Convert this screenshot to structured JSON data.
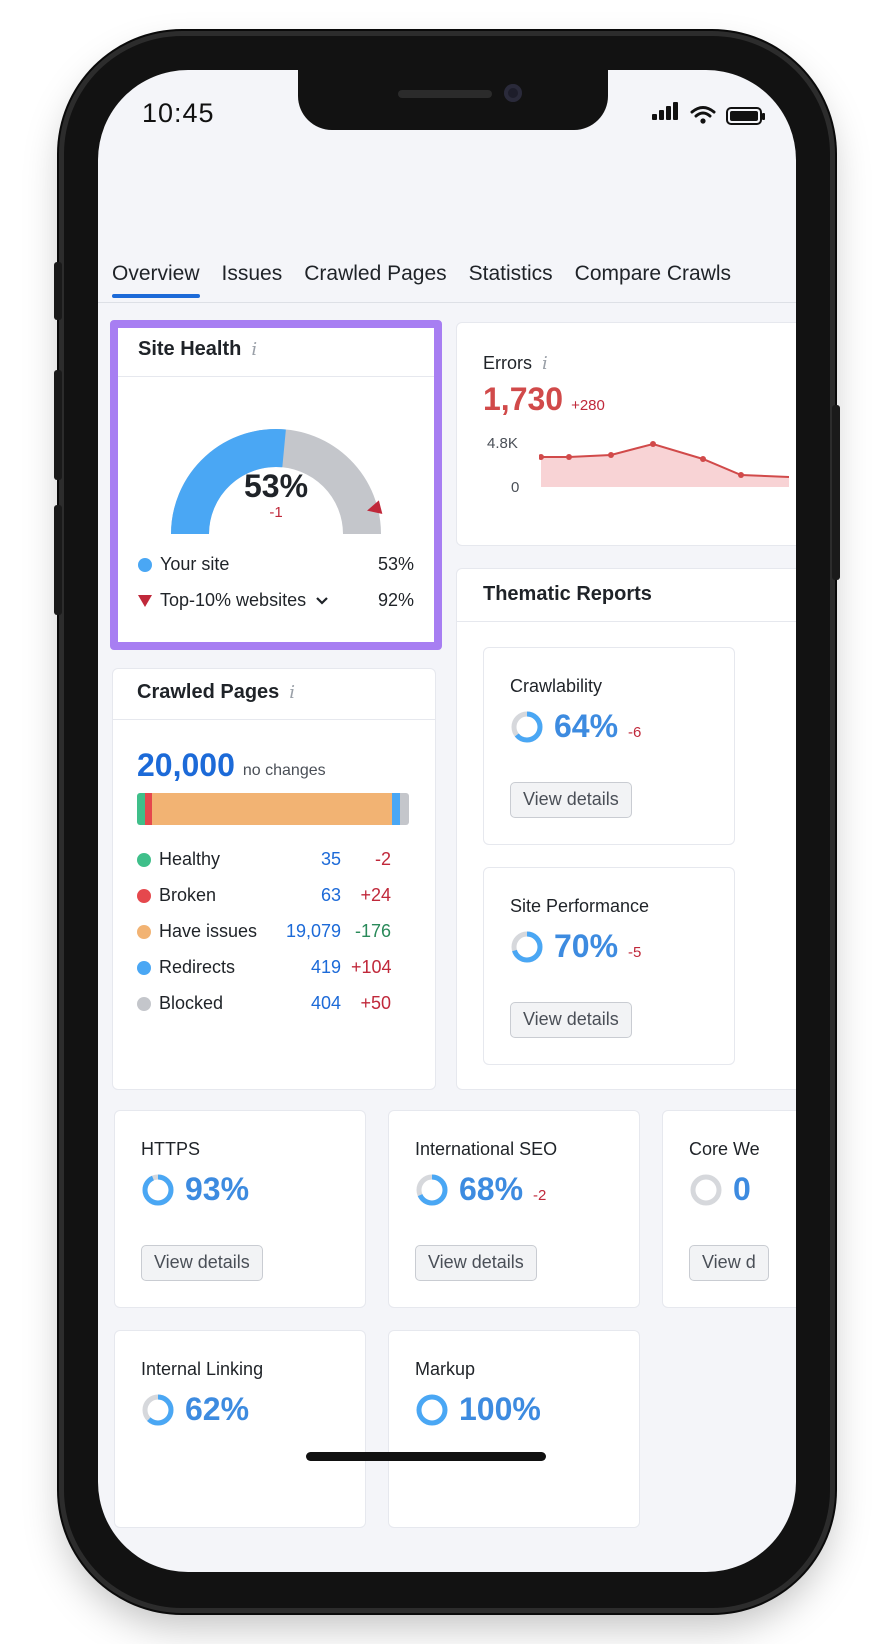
{
  "status_bar": {
    "time": "10:45"
  },
  "tabs": [
    {
      "label": "Overview",
      "active": true
    },
    {
      "label": "Issues"
    },
    {
      "label": "Crawled Pages"
    },
    {
      "label": "Statistics"
    },
    {
      "label": "Compare Crawls"
    }
  ],
  "site_health": {
    "title": "Site Health",
    "value": "53%",
    "delta": "-1",
    "gauge_fraction": 0.53,
    "top10_marker_fraction": 0.92,
    "legend": [
      {
        "label": "Your site",
        "value": "53%",
        "color": "#4aa7f4"
      },
      {
        "label": "Top-10% websites",
        "value": "92%",
        "color": "#c0283a"
      }
    ]
  },
  "errors": {
    "title": "Errors",
    "value": "1,730",
    "delta": "+280",
    "y_max_label": "4.8K",
    "y_min_label": "0"
  },
  "crawled_pages": {
    "title": "Crawled Pages",
    "total": "20,000",
    "total_note": "no changes",
    "rows": [
      {
        "label": "Healthy",
        "value": "35",
        "change": "-2",
        "color": "#3fbf8a",
        "change_color": "#c0283a"
      },
      {
        "label": "Broken",
        "value": "63",
        "change": "+24",
        "color": "#e5484d",
        "change_color": "#c0283a"
      },
      {
        "label": "Have issues",
        "value": "19,079",
        "change": "-176",
        "color": "#f2b373",
        "change_color": "#2a8a5a"
      },
      {
        "label": "Redirects",
        "value": "419",
        "change": "+104",
        "color": "#4aa7f4",
        "change_color": "#c0283a"
      },
      {
        "label": "Blocked",
        "value": "404",
        "change": "+50",
        "color": "#c4c6cb",
        "change_color": "#c0283a"
      }
    ]
  },
  "thematic": {
    "title": "Thematic Reports",
    "items": [
      {
        "label": "Crawlability",
        "value": "64%",
        "delta": "-6",
        "button": "View details"
      },
      {
        "label": "Site Performance",
        "value": "70%",
        "delta": "-5",
        "button": "View details"
      }
    ]
  },
  "bottom_cards": [
    {
      "label": "HTTPS",
      "value": "93%",
      "delta": "",
      "button": "View details"
    },
    {
      "label": "International SEO",
      "value": "68%",
      "delta": "-2",
      "button": "View details"
    },
    {
      "label": "Core We",
      "value": "0",
      "delta": "",
      "button": "View d"
    },
    {
      "label": "Internal Linking",
      "value": "62%",
      "delta": ""
    },
    {
      "label": "Markup",
      "value": "100%",
      "delta": ""
    }
  ],
  "colors": {
    "accent": "#1c6ad8",
    "highlight": "#a77ef2",
    "negative": "#c0283a"
  }
}
